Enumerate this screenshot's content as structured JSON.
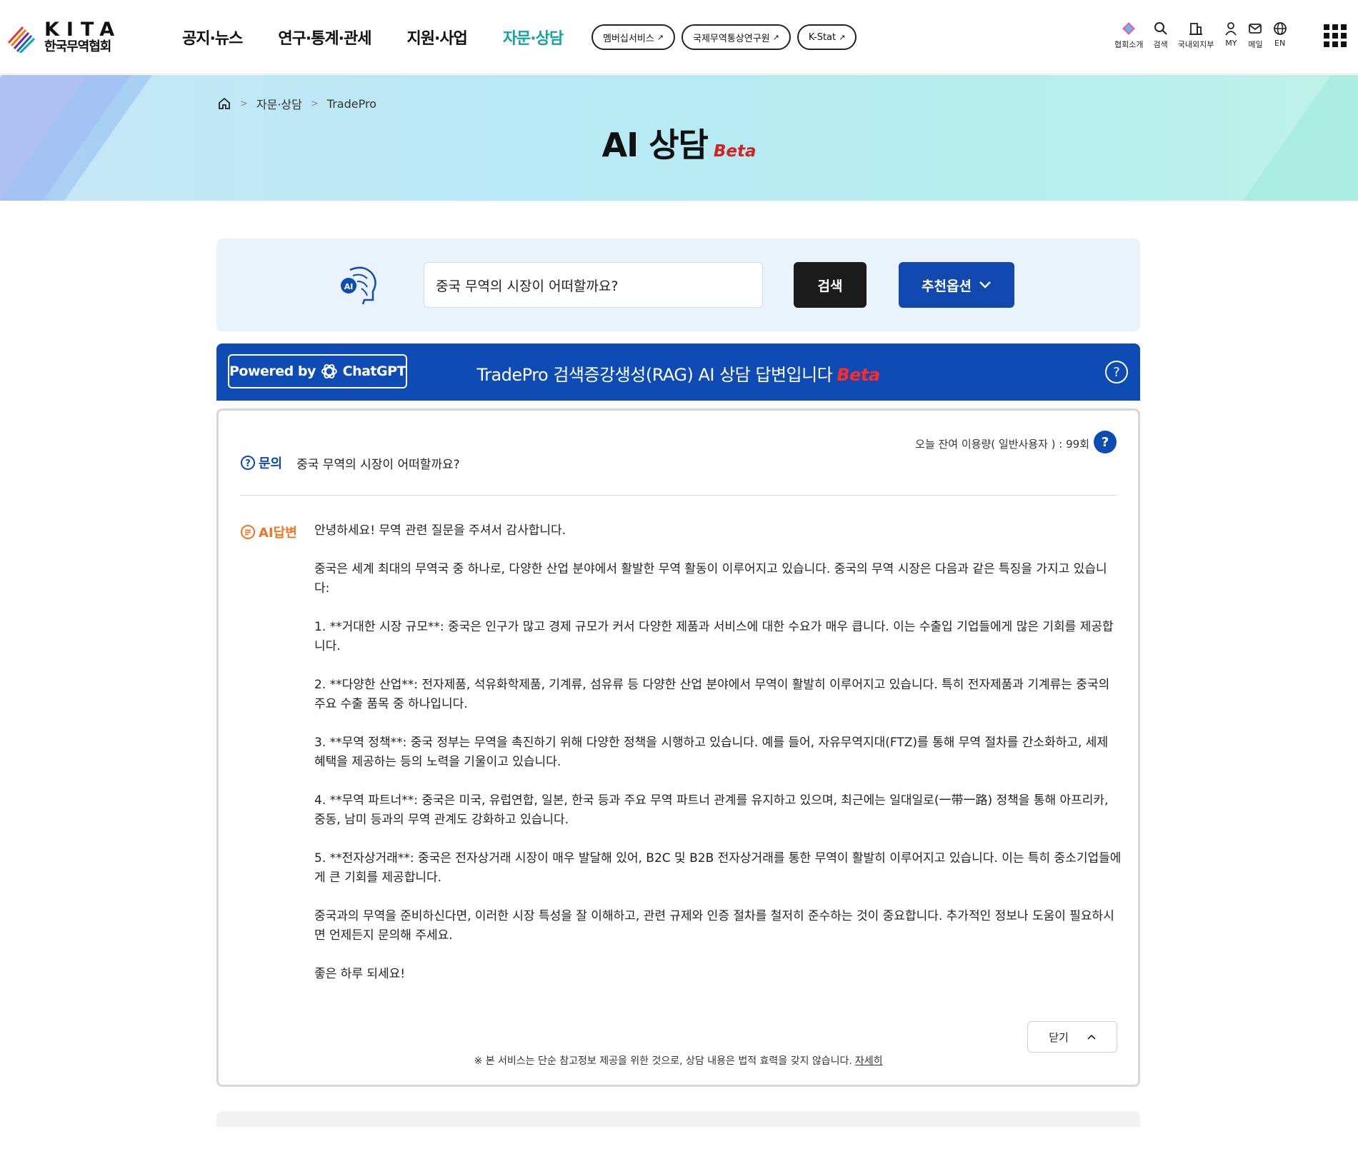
{
  "logo": {
    "kita": "KITA",
    "name": "한국무역협회"
  },
  "gnb": [
    {
      "label": "공지·뉴스",
      "active": false
    },
    {
      "label": "연구·통계·관세",
      "active": false
    },
    {
      "label": "지원·사업",
      "active": false
    },
    {
      "label": "자문·상담",
      "active": true
    }
  ],
  "pill_links": [
    "멤버십서비스",
    "국제무역통상연구원",
    "K-Stat"
  ],
  "util": {
    "about": "협회소개",
    "search": "검색",
    "branches": "국내외지부",
    "my": "MY",
    "mail": "메일",
    "en": "EN"
  },
  "breadcrumb": {
    "level1": "자문·상담",
    "level2": "TradePro"
  },
  "hero": {
    "title": "AI 상담",
    "beta": "Beta"
  },
  "search": {
    "value": "중국 무역의 시장이 어떠할까요?",
    "button": "검색",
    "recommend": "추천옵션"
  },
  "banner": {
    "powered_prefix": "Powered by",
    "powered_brand": "ChatGPT",
    "title": "TradePro 검색증강생성(RAG) AI 상담 답변입니다",
    "beta": "Beta"
  },
  "answer_box": {
    "usage": "오늘 잔여 이용량( 일반사용자 ) :  99회",
    "question_label": "문의",
    "question_text": "중국 무역의 시장이 어떠할까요?",
    "answer_label": "AI답변",
    "paragraphs": [
      "안녕하세요! 무역 관련 질문을 주셔서 감사합니다.",
      "중국은 세계 최대의 무역국 중 하나로, 다양한 산업 분야에서 활발한 무역 활동이 이루어지고 있습니다. 중국의 무역 시장은 다음과 같은 특징을 가지고 있습니다:",
      "1. **거대한 시장 규모**: 중국은 인구가 많고 경제 규모가 커서 다양한 제품과 서비스에 대한 수요가 매우 큽니다. 이는 수출입 기업들에게 많은 기회를 제공합니다.",
      "2. **다양한 산업**: 전자제품, 석유화학제품, 기계류, 섬유류 등 다양한 산업 분야에서 무역이 활발히 이루어지고 있습니다. 특히 전자제품과 기계류는 중국의 주요 수출 품목 중 하나입니다.",
      "3. **무역 정책**: 중국 정부는 무역을 촉진하기 위해 다양한 정책을 시행하고 있습니다. 예를 들어, 자유무역지대(FTZ)를 통해 무역 절차를 간소화하고, 세제 혜택을 제공하는 등의 노력을 기울이고 있습니다.",
      "4. **무역 파트너**: 중국은 미국, 유럽연합, 일본, 한국 등과 주요 무역 파트너 관계를 유지하고 있으며, 최근에는 일대일로(一带一路) 정책을 통해 아프리카, 중동, 남미 등과의 무역 관계도 강화하고 있습니다.",
      "5. **전자상거래**: 중국은 전자상거래 시장이 매우 발달해 있어, B2C 및 B2B 전자상거래를 통한 무역이 활발히 이루어지고 있습니다. 이는 특히 중소기업들에게 큰 기회를 제공합니다.",
      "중국과의 무역을 준비하신다면, 이러한 시장 특성을 잘 이해하고, 관련 규제와 인증 절차를 철저히 준수하는 것이 중요합니다. 추가적인 정보나 도움이 필요하시면 언제든지 문의해 주세요.",
      "좋은 하루 되세요!"
    ],
    "close_label": "닫기",
    "disclaimer": "※ 본 서비스는 단순 참고정보 제공을 위한 것으로, 상담 내용은 법적 효력을 갖지 않습니다.",
    "disclaimer_link": "자세히"
  },
  "colors": {
    "primary_blue": "#0e4bb4",
    "accent_teal": "#15a3a3",
    "answer_orange": "#f07424",
    "beta_red": "#d62020"
  }
}
